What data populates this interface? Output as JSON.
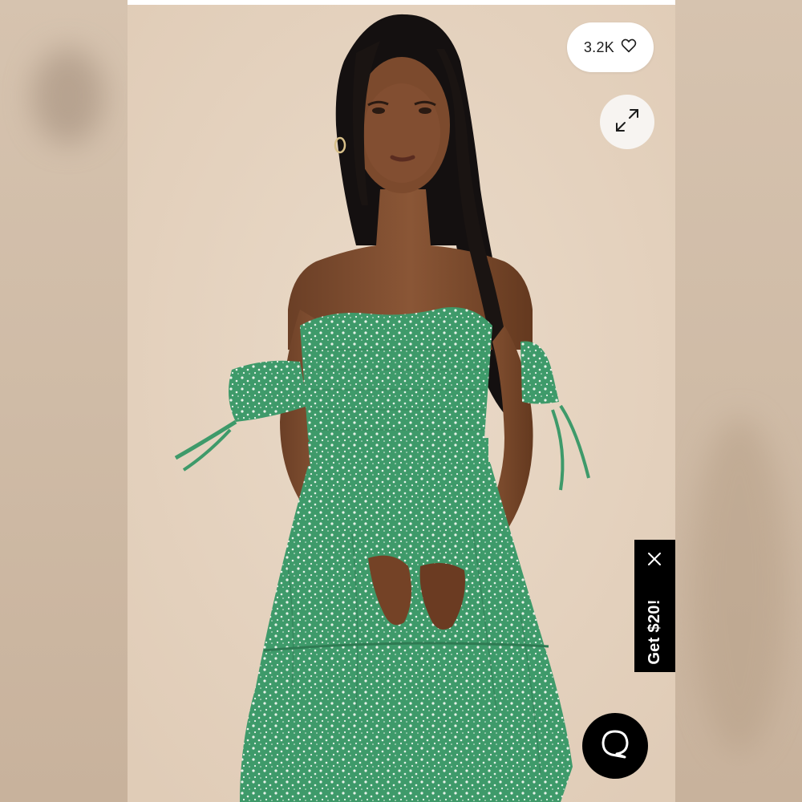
{
  "product_gallery": {
    "like_count": "3.2K",
    "like_icon": "heart-outline-icon",
    "expand_icon": "expand-arrows-icon"
  },
  "promo": {
    "label": "Get $20!",
    "close_icon": "close-icon"
  },
  "chat": {
    "icon": "chat-bubble-icon"
  },
  "colors": {
    "photo_background": "#e7d5c2",
    "dress_green": "#3e9a6a",
    "promo_background": "#000000",
    "chat_background": "#000000"
  }
}
